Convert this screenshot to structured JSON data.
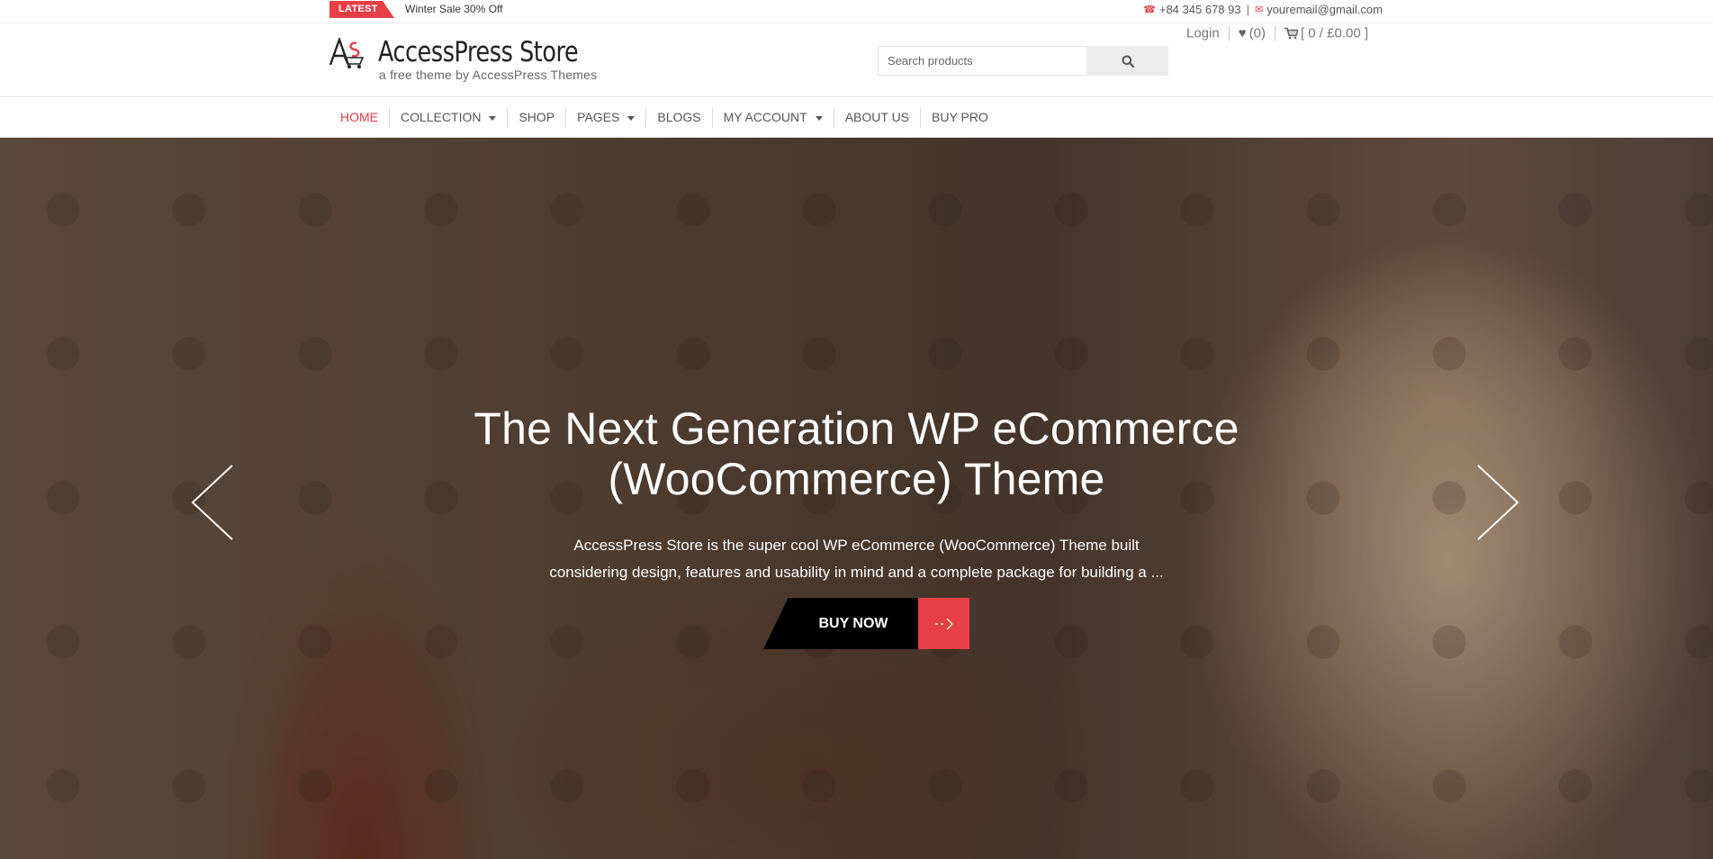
{
  "topbar": {
    "latest_label": "LATEST",
    "latest_text": "Winter Sale 30% Off",
    "phone": "+84 345 678 93",
    "separator": "|",
    "email": "youremail@gmail.com"
  },
  "header": {
    "site_title": "AccessPress Store",
    "tagline": "a free theme by AccessPress Themes",
    "search_placeholder": "Search products",
    "login": "Login",
    "wishlist": "(0)",
    "cart": "[ 0 / £0.00 ]"
  },
  "nav": {
    "items": [
      {
        "label": "HOME"
      },
      {
        "label": "COLLECTION"
      },
      {
        "label": "SHOP"
      },
      {
        "label": "PAGES"
      },
      {
        "label": "BLOGS"
      },
      {
        "label": "MY ACCOUNT"
      },
      {
        "label": "ABOUT US"
      },
      {
        "label": "BUY PRO"
      }
    ]
  },
  "hero": {
    "title_line1": "The Next Generation WP eCommerce",
    "title_line2": "(WooCommerce) Theme",
    "desc_line1": "AccessPress Store is the super cool WP eCommerce (WooCommerce) Theme  built",
    "desc_line2": "considering design, features and usability in mind and a complete package for building a ...",
    "button_label": "BUY NOW"
  },
  "colors": {
    "accent": "#e83e45",
    "text": "#333333"
  }
}
